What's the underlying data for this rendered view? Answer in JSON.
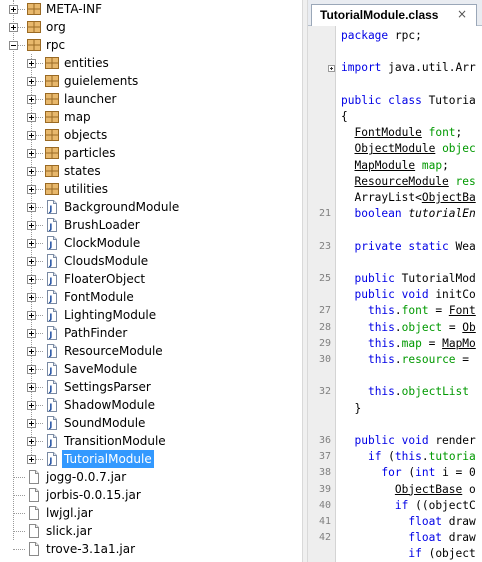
{
  "project_tree": {
    "items": [
      {
        "label": "META-INF",
        "type": "package",
        "toggle": "plus"
      },
      {
        "label": "org",
        "type": "package",
        "toggle": "plus"
      },
      {
        "label": "rpc",
        "type": "package",
        "toggle": "minus"
      },
      {
        "label": "entities",
        "type": "package",
        "toggle": "plus"
      },
      {
        "label": "guielements",
        "type": "package",
        "toggle": "plus"
      },
      {
        "label": "launcher",
        "type": "package",
        "toggle": "plus"
      },
      {
        "label": "map",
        "type": "package",
        "toggle": "plus"
      },
      {
        "label": "objects",
        "type": "package",
        "toggle": "plus"
      },
      {
        "label": "particles",
        "type": "package",
        "toggle": "plus"
      },
      {
        "label": "states",
        "type": "package",
        "toggle": "plus"
      },
      {
        "label": "utilities",
        "type": "package",
        "toggle": "plus"
      },
      {
        "label": "BackgroundModule",
        "type": "class",
        "toggle": "plus"
      },
      {
        "label": "BrushLoader",
        "type": "class",
        "toggle": "plus"
      },
      {
        "label": "ClockModule",
        "type": "class",
        "toggle": "plus"
      },
      {
        "label": "CloudsModule",
        "type": "class",
        "toggle": "plus"
      },
      {
        "label": "FloaterObject",
        "type": "class",
        "toggle": "plus"
      },
      {
        "label": "FontModule",
        "type": "class",
        "toggle": "plus"
      },
      {
        "label": "LightingModule",
        "type": "class",
        "toggle": "plus"
      },
      {
        "label": "PathFinder",
        "type": "class",
        "toggle": "plus"
      },
      {
        "label": "ResourceModule",
        "type": "class",
        "toggle": "plus"
      },
      {
        "label": "SaveModule",
        "type": "class",
        "toggle": "plus"
      },
      {
        "label": "SettingsParser",
        "type": "class",
        "toggle": "plus"
      },
      {
        "label": "ShadowModule",
        "type": "class",
        "toggle": "plus"
      },
      {
        "label": "SoundModule",
        "type": "class",
        "toggle": "plus"
      },
      {
        "label": "TransitionModule",
        "type": "class",
        "toggle": "plus"
      },
      {
        "label": "TutorialModule",
        "type": "class",
        "toggle": "plus",
        "selected": true
      },
      {
        "label": "jogg-0.0.7.jar",
        "type": "file"
      },
      {
        "label": "jorbis-0.0.15.jar",
        "type": "file"
      },
      {
        "label": "lwjgl.jar",
        "type": "file"
      },
      {
        "label": "slick.jar",
        "type": "file"
      },
      {
        "label": "trove-3.1a1.jar",
        "type": "file"
      }
    ]
  },
  "editor": {
    "tab_label": "TutorialModule.class",
    "close_glyph": "×",
    "fold_marker_row": 2,
    "line_numbers": [
      {
        "row": 11,
        "n": "21"
      },
      {
        "row": 13,
        "n": "23"
      },
      {
        "row": 15,
        "n": "25"
      },
      {
        "row": 17,
        "n": "27"
      },
      {
        "row": 18,
        "n": "28"
      },
      {
        "row": 19,
        "n": "29"
      },
      {
        "row": 20,
        "n": "30"
      },
      {
        "row": 22,
        "n": "32"
      },
      {
        "row": 25,
        "n": "36"
      },
      {
        "row": 26,
        "n": "37"
      },
      {
        "row": 27,
        "n": "38"
      },
      {
        "row": 28,
        "n": "39"
      },
      {
        "row": 29,
        "n": "40"
      },
      {
        "row": 30,
        "n": "41"
      },
      {
        "row": 31,
        "n": "42"
      }
    ],
    "code_lines": [
      [
        {
          "t": "package",
          "c": "k"
        },
        {
          "t": " rpc;"
        }
      ],
      [],
      [
        {
          "t": "import",
          "c": "k"
        },
        {
          "t": " java.util.Arr"
        }
      ],
      [],
      [
        {
          "t": "public class",
          "c": "k"
        },
        {
          "t": " Tutoria"
        }
      ],
      [
        {
          "t": "{"
        }
      ],
      [
        {
          "t": "  "
        },
        {
          "t": "FontModule",
          "c": "t"
        },
        {
          "t": " "
        },
        {
          "t": "font",
          "c": "f"
        },
        {
          "t": ";"
        }
      ],
      [
        {
          "t": "  "
        },
        {
          "t": "ObjectModule",
          "c": "t"
        },
        {
          "t": " "
        },
        {
          "t": "objec",
          "c": "f"
        }
      ],
      [
        {
          "t": "  "
        },
        {
          "t": "MapModule",
          "c": "t"
        },
        {
          "t": " "
        },
        {
          "t": "map",
          "c": "f"
        },
        {
          "t": ";"
        }
      ],
      [
        {
          "t": "  "
        },
        {
          "t": "ResourceModule",
          "c": "t"
        },
        {
          "t": " "
        },
        {
          "t": "res",
          "c": "f"
        }
      ],
      [
        {
          "t": "  ArrayList<"
        },
        {
          "t": "ObjectBa",
          "c": "t"
        }
      ],
      [
        {
          "t": "  "
        },
        {
          "t": "boolean",
          "c": "k"
        },
        {
          "t": " "
        },
        {
          "t": "tutorialEn",
          "c": "f i"
        }
      ],
      [],
      [
        {
          "t": "  "
        },
        {
          "t": "private static",
          "c": "k"
        },
        {
          "t": " Wea"
        }
      ],
      [],
      [
        {
          "t": "  "
        },
        {
          "t": "public",
          "c": "k"
        },
        {
          "t": " TutorialMod"
        }
      ],
      [
        {
          "t": "  "
        },
        {
          "t": "public void",
          "c": "k"
        },
        {
          "t": " initCo"
        }
      ],
      [
        {
          "t": "    "
        },
        {
          "t": "this",
          "c": "k"
        },
        {
          "t": "."
        },
        {
          "t": "font",
          "c": "f"
        },
        {
          "t": " = "
        },
        {
          "t": "Font",
          "c": "t"
        }
      ],
      [
        {
          "t": "    "
        },
        {
          "t": "this",
          "c": "k"
        },
        {
          "t": "."
        },
        {
          "t": "object",
          "c": "f"
        },
        {
          "t": " = "
        },
        {
          "t": "Ob",
          "c": "t"
        }
      ],
      [
        {
          "t": "    "
        },
        {
          "t": "this",
          "c": "k"
        },
        {
          "t": "."
        },
        {
          "t": "map",
          "c": "f"
        },
        {
          "t": " = "
        },
        {
          "t": "MapMo",
          "c": "t"
        }
      ],
      [
        {
          "t": "    "
        },
        {
          "t": "this",
          "c": "k"
        },
        {
          "t": "."
        },
        {
          "t": "resource",
          "c": "f"
        },
        {
          "t": " ="
        }
      ],
      [],
      [
        {
          "t": "    "
        },
        {
          "t": "this",
          "c": "k"
        },
        {
          "t": "."
        },
        {
          "t": "objectList",
          "c": "f"
        }
      ],
      [
        {
          "t": "  }"
        }
      ],
      [],
      [
        {
          "t": "  "
        },
        {
          "t": "public void",
          "c": "k"
        },
        {
          "t": " render"
        }
      ],
      [
        {
          "t": "    "
        },
        {
          "t": "if",
          "c": "k"
        },
        {
          "t": " ("
        },
        {
          "t": "this",
          "c": "k"
        },
        {
          "t": "."
        },
        {
          "t": "tutoria",
          "c": "f"
        }
      ],
      [
        {
          "t": "      "
        },
        {
          "t": "for",
          "c": "k"
        },
        {
          "t": " ("
        },
        {
          "t": "int",
          "c": "k"
        },
        {
          "t": " i = 0"
        }
      ],
      [
        {
          "t": "        "
        },
        {
          "t": "ObjectBase",
          "c": "t"
        },
        {
          "t": " o"
        }
      ],
      [
        {
          "t": "        "
        },
        {
          "t": "if",
          "c": "k"
        },
        {
          "t": " ((objectC"
        }
      ],
      [
        {
          "t": "          "
        },
        {
          "t": "float",
          "c": "k"
        },
        {
          "t": " draw"
        }
      ],
      [
        {
          "t": "          "
        },
        {
          "t": "float",
          "c": "k"
        },
        {
          "t": " draw"
        }
      ],
      [
        {
          "t": "          "
        },
        {
          "t": "if",
          "c": "k"
        },
        {
          "t": " (object"
        }
      ]
    ]
  }
}
